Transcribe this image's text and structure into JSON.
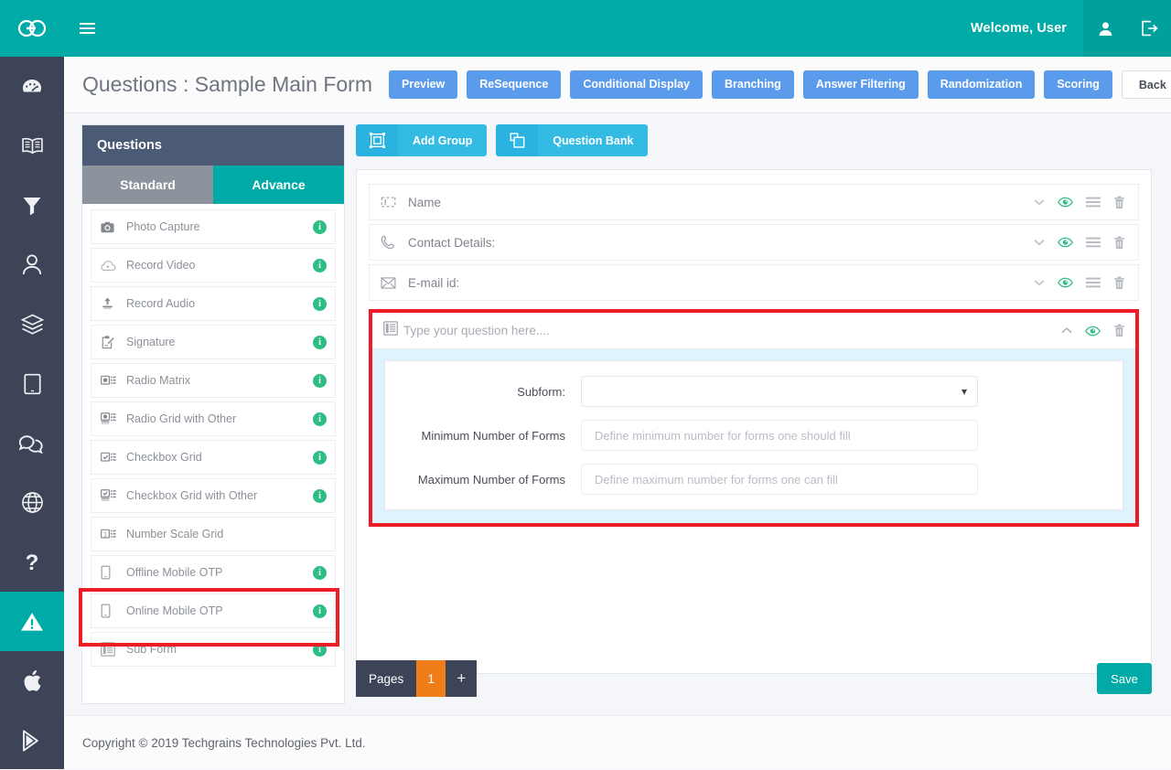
{
  "topbar": {
    "logo_icon": "go-infinity-logo",
    "menu_icon": "hamburger-menu-icon",
    "welcome_text": "Welcome, User",
    "profile_icon": "user-icon",
    "logout_icon": "logout-icon",
    "bg_color": "#00aaa6"
  },
  "rail": {
    "items": [
      {
        "icon": "dashboard-gauge-icon",
        "active": false
      },
      {
        "icon": "book-icon",
        "active": false
      },
      {
        "icon": "filter-funnel-icon",
        "active": false
      },
      {
        "icon": "user-icon",
        "active": false
      },
      {
        "icon": "layers-icon",
        "active": false
      },
      {
        "icon": "tablet-icon",
        "active": false
      },
      {
        "icon": "chat-bubbles-icon",
        "active": false
      },
      {
        "icon": "globe-icon",
        "active": false
      },
      {
        "icon": "question-mark-icon",
        "active": false
      },
      {
        "icon": "warning-triangle-icon",
        "active": true
      },
      {
        "icon": "apple-icon",
        "active": false
      },
      {
        "icon": "google-play-icon",
        "active": false
      }
    ],
    "bg_color": "#3d4457",
    "active_color": "#00aaa6"
  },
  "page_header": {
    "title": "Questions : Sample Main Form",
    "buttons": [
      {
        "label": "Preview",
        "style": "primary"
      },
      {
        "label": "ReSequence",
        "style": "primary"
      },
      {
        "label": "Conditional Display",
        "style": "primary"
      },
      {
        "label": "Branching",
        "style": "primary"
      },
      {
        "label": "Answer Filtering",
        "style": "primary"
      },
      {
        "label": "Randomization",
        "style": "primary"
      },
      {
        "label": "Scoring",
        "style": "primary"
      },
      {
        "label": "Back",
        "style": "ghost"
      }
    ],
    "primary_color": "#5b9bec"
  },
  "questions_panel": {
    "title": "Questions",
    "tabs": [
      {
        "label": "Standard",
        "selected": false
      },
      {
        "label": "Advance",
        "selected": true
      }
    ],
    "items": [
      {
        "label": "Photo Capture",
        "icon": "camera-icon",
        "has_info": true
      },
      {
        "label": "Record Video",
        "icon": "video-cloud-icon",
        "has_info": true
      },
      {
        "label": "Record Audio",
        "icon": "audio-upload-icon",
        "has_info": true
      },
      {
        "label": "Signature",
        "icon": "signature-icon",
        "has_info": true
      },
      {
        "label": "Radio Matrix",
        "icon": "radio-matrix-icon",
        "has_info": true
      },
      {
        "label": "Radio Grid with Other",
        "icon": "radio-grid-other-icon",
        "has_info": true
      },
      {
        "label": "Checkbox Grid",
        "icon": "checkbox-grid-icon",
        "has_info": true
      },
      {
        "label": "Checkbox Grid with Other",
        "icon": "checkbox-grid-other-icon",
        "has_info": true
      },
      {
        "label": "Number Scale Grid",
        "icon": "number-scale-grid-icon",
        "has_info": false
      },
      {
        "label": "Offline Mobile OTP",
        "icon": "mobile-icon",
        "has_info": true
      },
      {
        "label": "Online Mobile OTP",
        "icon": "mobile-icon",
        "has_info": true
      },
      {
        "label": "Sub Form",
        "icon": "sub-form-icon",
        "has_info": true,
        "highlighted": true
      }
    ],
    "info_badge_char": "i",
    "header_color": "#4c5b75"
  },
  "main_toolbar": {
    "buttons": [
      {
        "label": "Add Group",
        "icon": "add-group-icon"
      },
      {
        "label": "Question Bank",
        "icon": "question-bank-icon"
      }
    ],
    "color": "#34bbe3"
  },
  "canvas": {
    "rows": [
      {
        "label": "Name",
        "icon": "text-field-icon",
        "expanded": false
      },
      {
        "label": "Contact Details:",
        "icon": "phone-icon",
        "expanded": false
      },
      {
        "label": "E-mail id:",
        "icon": "envelope-icon",
        "expanded": false
      }
    ],
    "row_actions": {
      "collapse_icon": "chevron-down-icon",
      "expand_icon": "chevron-up-icon",
      "visibility_icon": "eye-icon",
      "menu_icon": "list-menu-icon",
      "delete_icon": "trash-icon"
    },
    "subform_block": {
      "question_placeholder": "Type your question here....",
      "icon": "sub-form-icon",
      "expanded": true,
      "highlight_color": "#ee1c25",
      "panel_bg": "#ddf4fc",
      "fields": [
        {
          "label": "Subform:",
          "type": "select",
          "value": "",
          "placeholder": "",
          "caret": "▾"
        },
        {
          "label": "Minimum Number of Forms",
          "type": "text",
          "value": "",
          "placeholder": "Define minimum number for forms one should fill"
        },
        {
          "label": "Maximum Number of Forms",
          "type": "text",
          "value": "",
          "placeholder": "Define maximum number for forms one can fill"
        }
      ]
    }
  },
  "bottom": {
    "pages_label": "Pages",
    "current_page": "1",
    "add_page_label": "+",
    "save_label": "Save",
    "save_color": "#00aaa6",
    "page_active_color": "#ef7d1a"
  },
  "footer": {
    "copyright": "Copyright © 2019 Techgrains Technologies Pvt. Ltd."
  }
}
